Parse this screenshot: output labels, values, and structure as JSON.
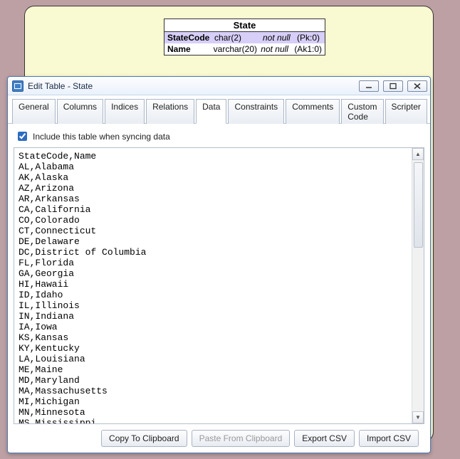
{
  "entity": {
    "title": "State",
    "columns": [
      {
        "name": "StateCode",
        "type": "char(2)",
        "null": "not null",
        "key": "(Pk:0)",
        "pk": true
      },
      {
        "name": "Name",
        "type": "varchar(20)",
        "null": "not null",
        "key": "(Ak1:0)",
        "pk": false
      }
    ]
  },
  "dialog": {
    "title": "Edit Table - State",
    "tabs": [
      "General",
      "Columns",
      "Indices",
      "Relations",
      "Data",
      "Constraints",
      "Comments",
      "Custom Code",
      "Scripter"
    ],
    "activeTab": "Data",
    "includeLabel": "Include this table when syncing data",
    "includeChecked": true,
    "csv": "StateCode,Name\nAL,Alabama\nAK,Alaska\nAZ,Arizona\nAR,Arkansas\nCA,California\nCO,Colorado\nCT,Connecticut\nDE,Delaware\nDC,District of Columbia\nFL,Florida\nGA,Georgia\nHI,Hawaii\nID,Idaho\nIL,Illinois\nIN,Indiana\nIA,Iowa\nKS,Kansas\nKY,Kentucky\nLA,Louisiana\nME,Maine\nMD,Maryland\nMA,Massachusetts\nMI,Michigan\nMN,Minnesota\nMS,Mississippi\nMO,Missouri\nMT,Montana",
    "buttons": {
      "copy": "Copy To Clipboard",
      "paste": "Paste From Clipboard",
      "export": "Export CSV",
      "import": "Import CSV"
    }
  }
}
